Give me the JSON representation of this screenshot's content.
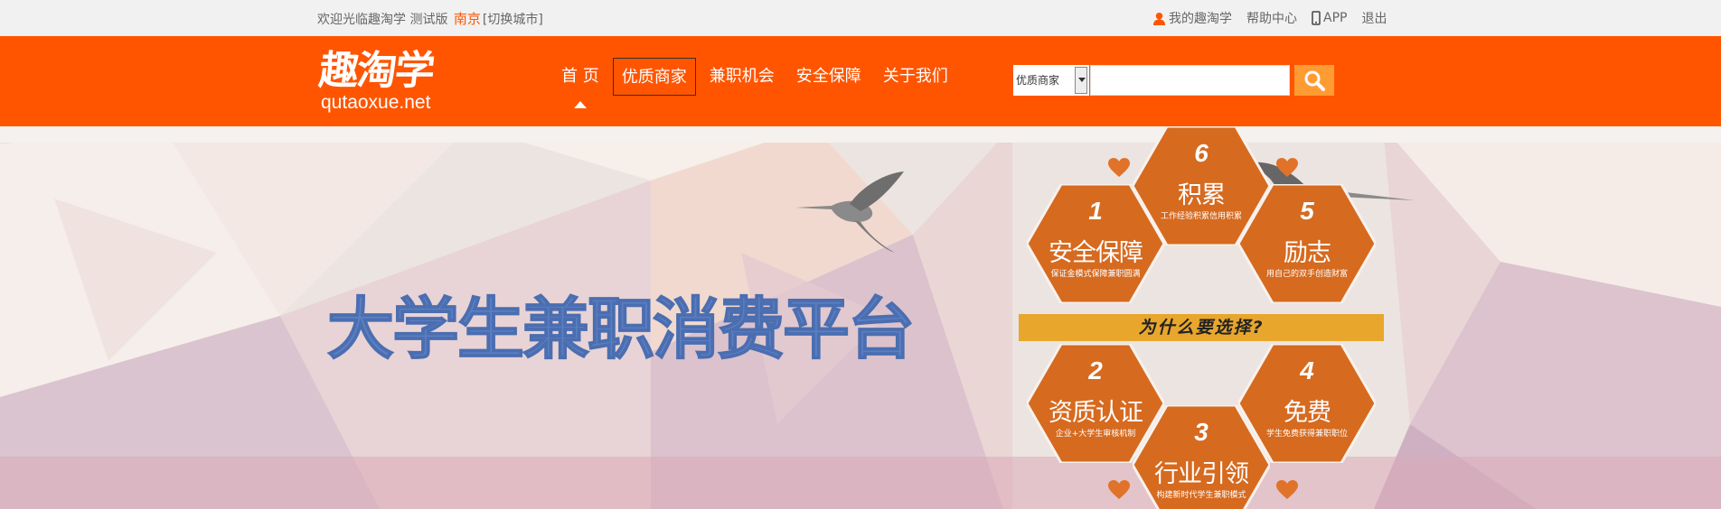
{
  "topbar": {
    "welcome": "欢迎光临趣淘学 测试版",
    "city": "南京",
    "switch_city": "[切换城市]",
    "my_account": "我的趣淘学",
    "help": "帮助中心",
    "app": "APP",
    "logout": "退出"
  },
  "header": {
    "logo_cn": "趣淘学",
    "logo_en": "qutaoxue.net",
    "nav": [
      "首 页",
      "优质商家",
      "兼职机会",
      "安全保障",
      "关于我们"
    ],
    "search_category": "优质商家",
    "search_value": ""
  },
  "banner": {
    "slogan": "大学生兼职消费平台",
    "why": "为什么要选择?",
    "features": [
      {
        "num": "1",
        "title": "安全保障",
        "desc": "保证金模式保障兼职圆满"
      },
      {
        "num": "2",
        "title": "资质认证",
        "desc": "企业+大学生审核机制"
      },
      {
        "num": "3",
        "title": "行业引领",
        "desc": "构建新时代学生兼职模式"
      },
      {
        "num": "4",
        "title": "免费",
        "desc": "学生免费获得兼职职位"
      },
      {
        "num": "5",
        "title": "励志",
        "desc": "用自己的双手创造财富"
      },
      {
        "num": "6",
        "title": "积累",
        "desc": "工作经验积累信用积累"
      }
    ]
  },
  "colors": {
    "brand": "#ff5500",
    "hexagon": "#d66a1f",
    "slogan": "#5b7fc2",
    "why_bar": "#e8a72c"
  },
  "icons": [
    "user-icon",
    "phone-icon",
    "search-icon",
    "caret-up-icon",
    "heart-icon",
    "hummingbird-icon"
  ]
}
